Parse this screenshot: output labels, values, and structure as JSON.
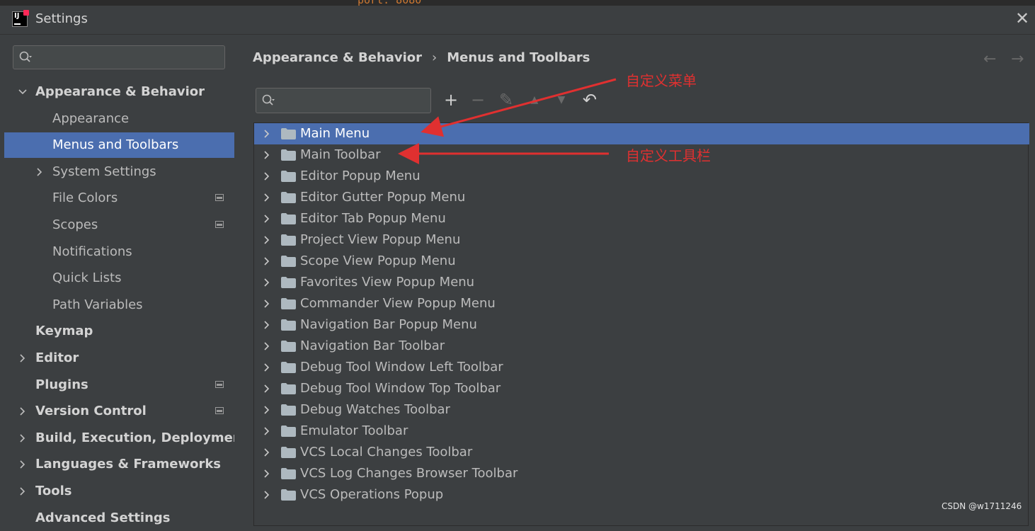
{
  "window": {
    "title": "Settings"
  },
  "search": {
    "placeholder": ""
  },
  "sidebar": {
    "items": [
      {
        "label": "Appearance & Behavior",
        "bold": true,
        "expanded": true,
        "indent": 0,
        "icon": "chevron-down"
      },
      {
        "label": "Appearance",
        "indent": 1
      },
      {
        "label": "Menus and Toolbars",
        "indent": 1,
        "selected": true
      },
      {
        "label": "System Settings",
        "indent": 1,
        "icon": "chevron-right"
      },
      {
        "label": "File Colors",
        "indent": 1,
        "project": true
      },
      {
        "label": "Scopes",
        "indent": 1,
        "project": true
      },
      {
        "label": "Notifications",
        "indent": 1
      },
      {
        "label": "Quick Lists",
        "indent": 1
      },
      {
        "label": "Path Variables",
        "indent": 1
      },
      {
        "label": "Keymap",
        "bold": true,
        "indent": 0
      },
      {
        "label": "Editor",
        "bold": true,
        "indent": 0,
        "icon": "chevron-right"
      },
      {
        "label": "Plugins",
        "bold": true,
        "indent": 0,
        "project": true
      },
      {
        "label": "Version Control",
        "bold": true,
        "indent": 0,
        "icon": "chevron-right",
        "project": true
      },
      {
        "label": "Build, Execution, Deployment",
        "bold": true,
        "indent": 0,
        "icon": "chevron-right"
      },
      {
        "label": "Languages & Frameworks",
        "bold": true,
        "indent": 0,
        "icon": "chevron-right"
      },
      {
        "label": "Tools",
        "bold": true,
        "indent": 0,
        "icon": "chevron-right"
      },
      {
        "label": "Advanced Settings",
        "bold": true,
        "indent": 0
      }
    ]
  },
  "breadcrumb": {
    "parent": "Appearance & Behavior",
    "current": "Menus and Toolbars"
  },
  "filter": {
    "placeholder": ""
  },
  "toolbar": {
    "add": "+",
    "remove": "−",
    "edit": "✎",
    "up": "▲",
    "down": "▼",
    "restore": "↶"
  },
  "menus": [
    "Main Menu",
    "Main Toolbar",
    "Editor Popup Menu",
    "Editor Gutter Popup Menu",
    "Editor Tab Popup Menu",
    "Project View Popup Menu",
    "Scope View Popup Menu",
    "Favorites View Popup Menu",
    "Commander View Popup Menu",
    "Navigation Bar Popup Menu",
    "Navigation Bar Toolbar",
    "Debug Tool Window Left Toolbar",
    "Debug Tool Window Top Toolbar",
    "Debug Watches Toolbar",
    "Emulator Toolbar",
    "VCS Local Changes Toolbar",
    "VCS Log Changes Browser Toolbar",
    "VCS Operations Popup"
  ],
  "selected_menu_index": 0,
  "annotations": {
    "menu": "自定义菜单",
    "toolbar": "自定义工具栏"
  },
  "watermark": "CSDN @w1711246",
  "colors": {
    "selection": "#4b6eaf",
    "background": "#3c3f41",
    "annotation": "#e03030"
  }
}
